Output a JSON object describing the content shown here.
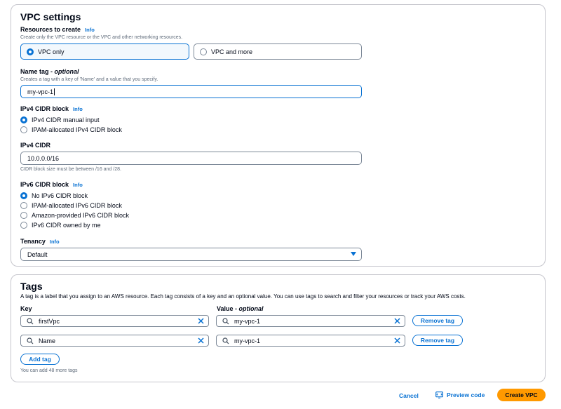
{
  "vpc_settings": {
    "title": "VPC settings",
    "resources_to_create": {
      "label": "Resources to create",
      "info": "Info",
      "description": "Create only the VPC resource or the VPC and other networking resources.",
      "options": [
        "VPC only",
        "VPC and more"
      ],
      "selected": "VPC only"
    },
    "name_tag": {
      "label": "Name tag - ",
      "optional": "optional",
      "description": "Creates a tag with a key of 'Name' and a value that you specify.",
      "value": "my-vpc-1"
    },
    "ipv4_cidr_block": {
      "label": "IPv4 CIDR block",
      "info": "Info",
      "options": [
        "IPv4 CIDR manual input",
        "IPAM-allocated IPv4 CIDR block"
      ],
      "selected": "IPv4 CIDR manual input"
    },
    "ipv4_cidr": {
      "label": "IPv4 CIDR",
      "value": "10.0.0.0/16",
      "constraint": "CIDR block size must be between /16 and /28."
    },
    "ipv6_cidr_block": {
      "label": "IPv6 CIDR block",
      "info": "Info",
      "options": [
        "No IPv6 CIDR block",
        "IPAM-allocated IPv6 CIDR block",
        "Amazon-provided IPv6 CIDR block",
        "IPv6 CIDR owned by me"
      ],
      "selected": "No IPv6 CIDR block"
    },
    "tenancy": {
      "label": "Tenancy",
      "info": "Info",
      "value": "Default"
    }
  },
  "tags": {
    "title": "Tags",
    "description": "A tag is a label that you assign to an AWS resource. Each tag consists of a key and an optional value. You can use tags to search and filter your resources or track your AWS costs.",
    "key_header": "Key",
    "value_header": "Value - ",
    "value_optional": "optional",
    "rows": [
      {
        "key": "firstVpc",
        "value": "my-vpc-1",
        "remove_label": "Remove tag"
      },
      {
        "key": "Name",
        "value": "my-vpc-1",
        "remove_label": "Remove tag"
      }
    ],
    "add_label": "Add tag",
    "remaining": "You can add 48 more tags"
  },
  "footer": {
    "cancel": "Cancel",
    "preview": "Preview code",
    "create": "Create VPC"
  },
  "colors": {
    "accent": "#0972d3",
    "primary_button": "#ff9900",
    "border": "#c6c6cd"
  },
  "icons": {
    "search": "search-icon",
    "clear": "close-icon",
    "select": "caret-down-icon",
    "preview": "code-preview-icon"
  }
}
